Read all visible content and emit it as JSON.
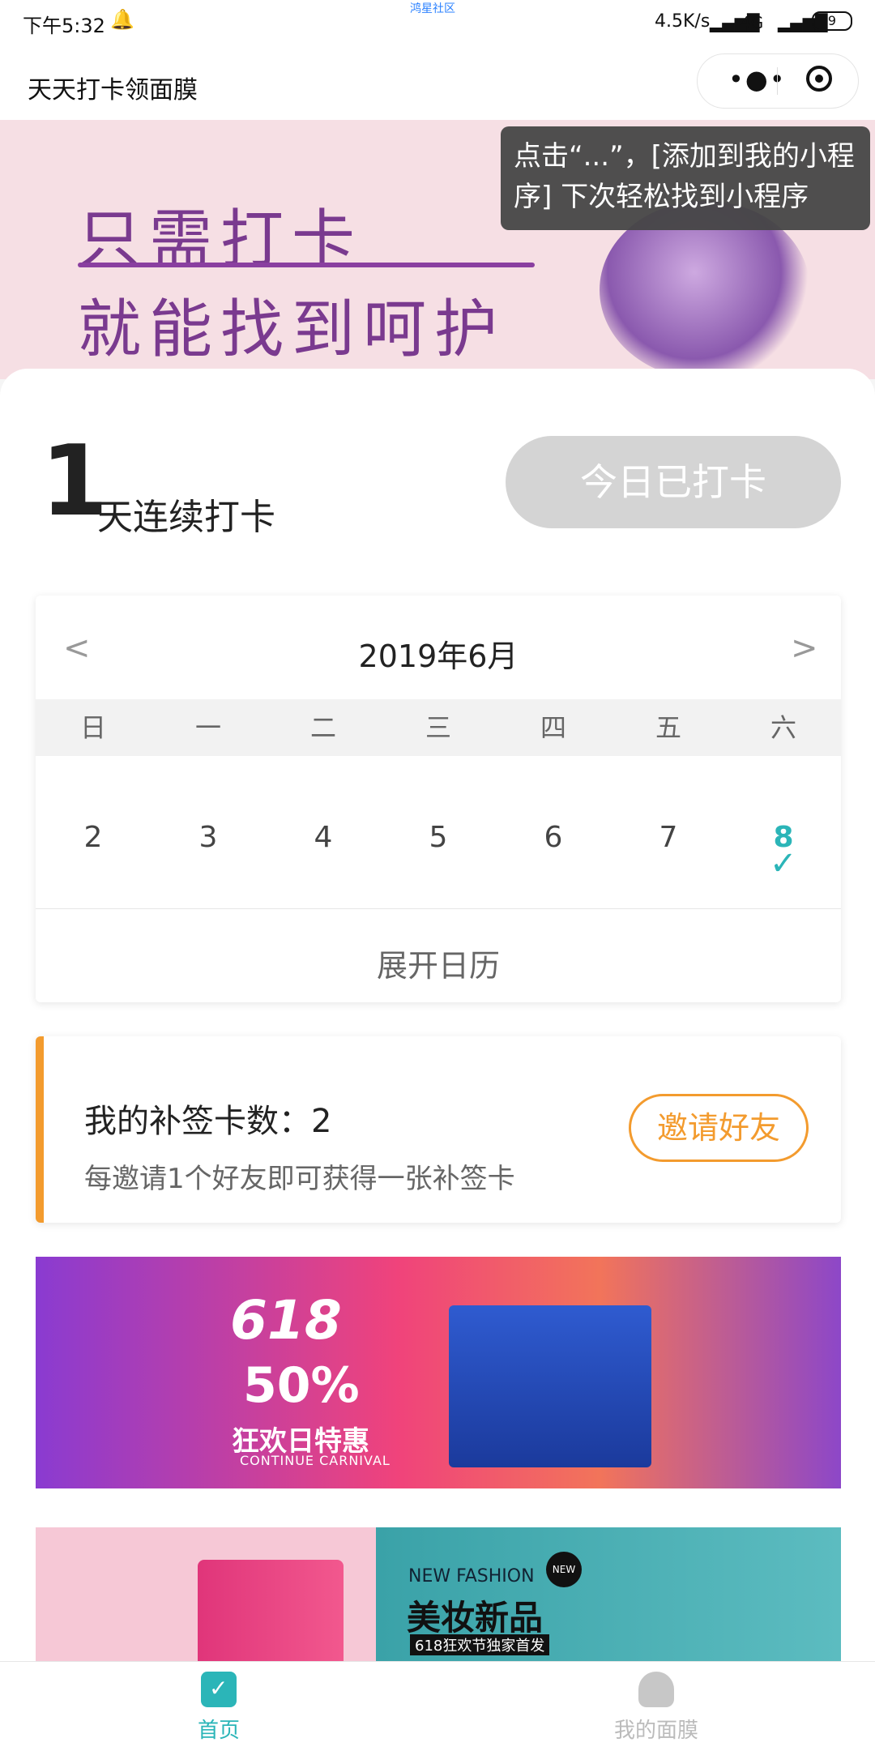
{
  "status_bar": {
    "time": "下午5:32",
    "carrier_label": "鸿星社区",
    "network_speed": "4.5K/s",
    "network_type": "4G",
    "battery": "9"
  },
  "nav": {
    "title": "天天打卡领面膜",
    "more_icon": "more-dots-icon",
    "close_icon": "target-icon"
  },
  "banner": {
    "line1": "只需打卡",
    "line2": "就能找到呵护",
    "tip": "点击“...”，[添加到我的小程序] 下次轻松找到小程序"
  },
  "streak": {
    "days": "1",
    "label": "天连续打卡",
    "button_label": "今日已打卡"
  },
  "calendar": {
    "month_title": "2019年6月",
    "weekdays": [
      "日",
      "一",
      "二",
      "三",
      "四",
      "五",
      "六"
    ],
    "days": [
      "2",
      "3",
      "4",
      "5",
      "6",
      "7",
      "8"
    ],
    "today_index": 6,
    "expand_label": "展开日历",
    "accent": "#2bb5b8"
  },
  "makeup_card": {
    "count_text": "我的补签卡数：2",
    "description": "每邀请1个好友即可获得一张补签卡",
    "invite_label": "邀请好友",
    "accent": "#f39b2e"
  },
  "promo1": {
    "big": "618",
    "percent": "50%",
    "text": "狂欢日特惠",
    "sub": "CONTINUE CARNIVAL"
  },
  "promo2": {
    "new_fashion": "NEW FASHION",
    "title": "美妆新品",
    "subtitle": "618狂欢节独家首发",
    "badge": "NEW"
  },
  "tabbar": {
    "home_label": "首页",
    "mine_label": "我的面膜"
  }
}
